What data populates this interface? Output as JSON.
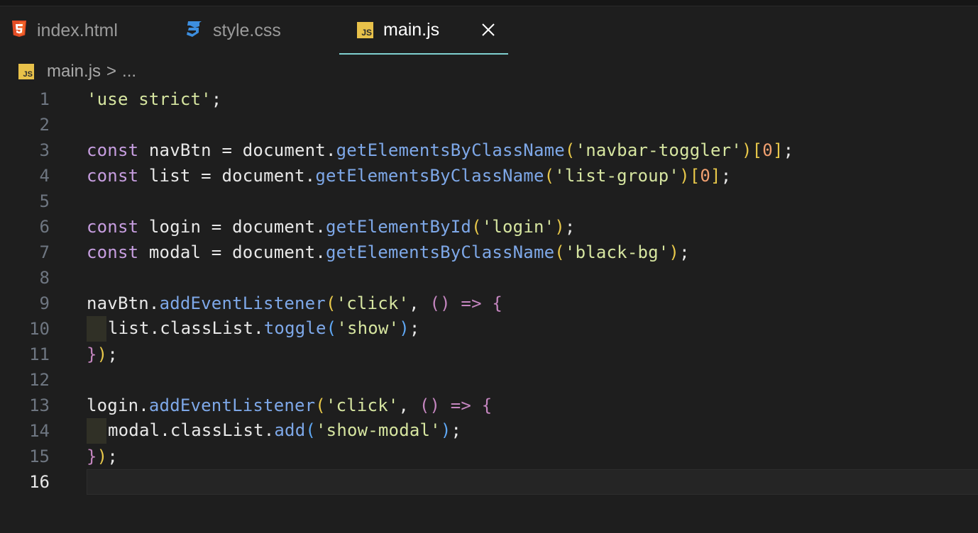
{
  "tabs": [
    {
      "label": "index.html",
      "icon": "html5-icon"
    },
    {
      "label": "style.css",
      "icon": "css3-icon"
    },
    {
      "label": "main.js",
      "icon": "js-file-icon",
      "active": true
    }
  ],
  "js_badge": "JS",
  "breadcrumb": {
    "file": "main.js",
    "separator": ">",
    "more": "..."
  },
  "colors": {
    "background": "#1e1e1e",
    "active_tab_border": "#7fd0d0",
    "keyword": "#c79ee0",
    "string": "#d6e5a0",
    "function": "#7ea8e8",
    "number": "#f0a070",
    "js_icon": "#e8c14a",
    "html_icon": "#e44d26",
    "css_icon": "#3d8fe0"
  },
  "lines": [
    {
      "n": "1"
    },
    {
      "n": "2"
    },
    {
      "n": "3"
    },
    {
      "n": "4"
    },
    {
      "n": "5"
    },
    {
      "n": "6"
    },
    {
      "n": "7"
    },
    {
      "n": "8"
    },
    {
      "n": "9"
    },
    {
      "n": "10"
    },
    {
      "n": "11"
    },
    {
      "n": "12"
    },
    {
      "n": "13"
    },
    {
      "n": "14"
    },
    {
      "n": "15"
    },
    {
      "n": "16"
    }
  ],
  "code": {
    "l1": "'use strict'",
    "semi": ";",
    "kw_const": "const",
    "eq": " = ",
    "dot": ".",
    "document": "document",
    "navBtn": "navBtn",
    "list": "list",
    "login": "login",
    "modal": "modal",
    "getElementsByClassName": "getElementsByClassName",
    "getElementById": "getElementById",
    "addEventListener": "addEventListener",
    "classList": "classList",
    "toggle": "toggle",
    "add": "add",
    "s_navbar_toggler": "'navbar-toggler'",
    "s_list_group": "'list-group'",
    "s_login": "'login'",
    "s_black_bg": "'black-bg'",
    "s_click": "'click'",
    "s_show": "'show'",
    "s_show_modal": "'show-modal'",
    "zero": "0",
    "lp": "(",
    "rp": ")",
    "lb": "[",
    "rb": "]",
    "lc": "{",
    "rc": "}",
    "comma": ", ",
    "empty_parens": "()",
    "arrow": " => "
  }
}
